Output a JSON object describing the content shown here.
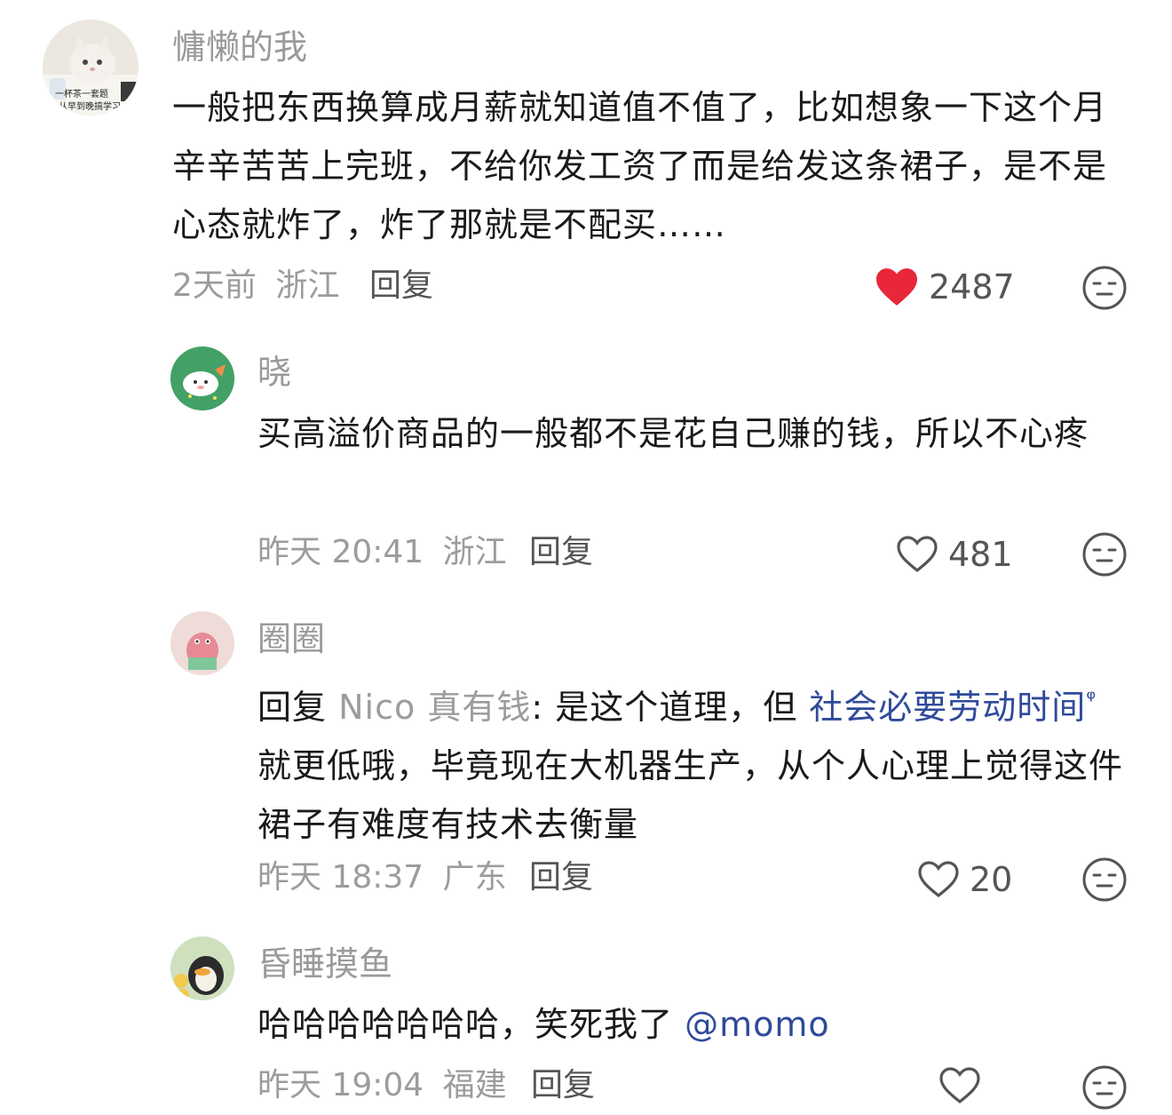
{
  "comments": [
    {
      "username": "慵懒的我",
      "text": "一般把东西换算成月薪就知道值不值了，比如想象一下这个月辛辛苦苦上完班，不给你发工资了而是给发这条裙子，是不是心态就炸了，炸了那就是不配买……",
      "avatar_caption_1": "一杯茶一套题",
      "avatar_caption_2": "从早到晚搞学习",
      "time": "2天前",
      "location": "浙江",
      "reply_label": "回复",
      "likes": "2487",
      "liked": true
    },
    {
      "username": "晓",
      "text": "买高溢价商品的一般都不是花自己赚的钱，所以不心疼",
      "time": "昨天 20:41",
      "location": "浙江",
      "reply_label": "回复",
      "likes": "481",
      "liked": false
    },
    {
      "username": "圈圈",
      "reply_prefix": "回复",
      "reply_target": "Nico 真有钱",
      "text_before_link": ": 是这个道理，但 ",
      "link_text": "社会必要劳动时间",
      "text_after_link": "就更低哦，毕竟现在大机器生产，从个人心理上觉得这件裙子有难度有技术去衡量",
      "time": "昨天 18:37",
      "location": "广东",
      "reply_label": "回复",
      "likes": "20",
      "liked": false
    },
    {
      "username": "昏睡摸鱼",
      "text": "哈哈哈哈哈哈哈，笑死我了 ",
      "mention": "@momo",
      "time": "昨天 19:04",
      "location": "福建",
      "reply_label": "回复",
      "likes": "",
      "liked": false
    }
  ],
  "colors": {
    "liked_heart": "#e8283a",
    "link": "#2f4a9a",
    "meta_text": "#9c9c9c"
  },
  "icons": {
    "like": "heart-icon",
    "dislike": "neutral-face-icon",
    "search": "search-icon"
  }
}
